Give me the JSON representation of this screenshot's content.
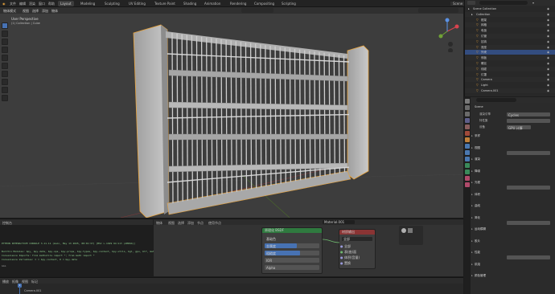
{
  "topbar": {
    "menus": [
      "文件",
      "编辑",
      "渲染",
      "窗口",
      "帮助"
    ],
    "tabs": [
      "Layout",
      "Modeling",
      "Sculpting",
      "UV Editing",
      "Texture Paint",
      "Shading",
      "Animation",
      "Rendering",
      "Compositing",
      "Scripting"
    ],
    "scene": "Scene",
    "view_layer": "View Layer"
  },
  "viewport": {
    "header_items": [
      "物体模式",
      "视图",
      "选择",
      "添加",
      "物体"
    ],
    "overlay_text": "User Perspective",
    "overlay_sub": "(1) Collection | Cube"
  },
  "outliner": {
    "rows": [
      {
        "label": "Scene Collection",
        "sel": false
      },
      {
        "label": "Collection",
        "sel": false
      },
      {
        "label": "框架",
        "sel": false
      },
      {
        "label": "网格",
        "sel": false
      },
      {
        "label": "电极",
        "sel": false
      },
      {
        "label": "灯管",
        "sel": false
      },
      {
        "label": "挂钩",
        "sel": false
      },
      {
        "label": "底座",
        "sel": false
      },
      {
        "label": "外壳",
        "sel": true
      },
      {
        "label": "侧板",
        "sel": false
      },
      {
        "label": "螺丝",
        "sel": false
      },
      {
        "label": "线缆",
        "sel": false
      },
      {
        "label": "灯罩",
        "sel": false
      },
      {
        "label": "Camera",
        "sel": false
      },
      {
        "label": "Light",
        "sel": false
      },
      {
        "label": "Camera.001",
        "sel": false
      }
    ]
  },
  "properties": {
    "object_name": "Scene",
    "fields": [
      {
        "label": "渲染引擎",
        "value": "Cycles"
      },
      {
        "label": "设备",
        "value": "GPU 计算"
      },
      {
        "label": "特性集",
        "value": "支持"
      }
    ],
    "sections": [
      "采样",
      "视图",
      "渲染",
      "降噪",
      "光程",
      "体积",
      "曲线",
      "简化",
      "运动模糊",
      "胶片",
      "性能",
      "烘焙",
      "颜色管理"
    ]
  },
  "console": {
    "title": "控制台",
    "lines": [
      "PYTHON INTERACTIVE CONSOLE 3.11.11 (main, May 13 2025, 00:01:37) [MSC v.1929 64 bit (AMD64)]",
      "",
      "Builtin Modules:       bpy, bpy.data, bpy.ops, bpy.props, bpy.types, bpy.context, bpy.utils, bgl, gpu, blf, mathutils",
      "Convenience Imports:   from mathutils import *; from math import *",
      "Convenience Variables: C = bpy.context, D = bpy.data",
      ">>>"
    ]
  },
  "node_editor": {
    "header_items": [
      "物体",
      "视图",
      "选择",
      "添加",
      "节点",
      "使用节点"
    ],
    "material": "Material.001",
    "node1_title": "原理化 BSDF",
    "node2_title": "材质输出",
    "node1_rows": [
      "基础色",
      "金属度",
      "粗糙度",
      "IOR",
      "Alpha"
    ],
    "node2_rows": [
      "全部",
      "表(曲)面",
      "体积(音量)",
      "置换"
    ],
    "output_target": "全部"
  },
  "timeline": {
    "items": [
      "播放",
      "抠像",
      "视图",
      "标记"
    ],
    "camera_label": "Camera.001",
    "frame": "1"
  },
  "colors": {
    "accent": "#4772b3",
    "selection_outline": "#e8a33c",
    "bsdf_header": "#2f7a3f",
    "output_header": "#8a3434"
  }
}
